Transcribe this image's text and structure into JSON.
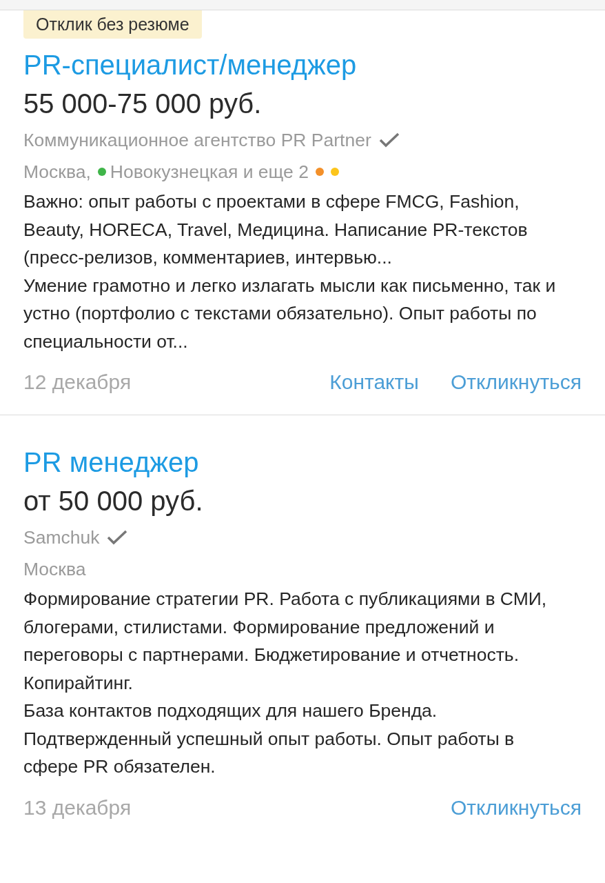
{
  "vacancies": [
    {
      "badge": "Отклик без резюме",
      "title": "PR-специалист/менеджер",
      "salary": "55 000-75 000 руб.",
      "company": "Коммуникационное агентство PR Partner",
      "verified": true,
      "city": "Москва,",
      "metro": {
        "name": "Новокузнецкая и еще 2",
        "color": "#3fb549"
      },
      "more_lines": [
        {
          "color": "#f3902a"
        },
        {
          "color": "#fcc51b"
        }
      ],
      "description": "Важно: опыт работы с проектами в сфере FMCG, Fashion, Beauty, HORECA, Travel, Медицина. Написание PR-текстов (пресс-релизов, комментариев, интервью...\nУмение грамотно и легко излагать мысли как письменно, так и устно (портфолио с текстами обязательно). Опыт работы по специальности от...",
      "date": "12 декабря",
      "actions": [
        {
          "label": "Контакты",
          "kind": "contacts"
        },
        {
          "label": "Откликнуться",
          "kind": "respond"
        }
      ]
    },
    {
      "title": "PR менеджер",
      "salary": "от 50 000 руб.",
      "company": "Samchuk",
      "verified": true,
      "city": "Москва",
      "description": "Формирование стратегии PR. Работа с публикациями в СМИ, блогерами, стилистами. Формирование предложений и переговоры с партнерами. Бюджетирование и отчетность. Копирайтинг.\nБаза контактов подходящих для нашего Бренда.\nПодтвержденный успешный опыт работы. Опыт работы в сфере PR обязателен.",
      "date": "13 декабря",
      "actions": [
        {
          "label": "Откликнуться",
          "kind": "respond"
        }
      ]
    }
  ]
}
